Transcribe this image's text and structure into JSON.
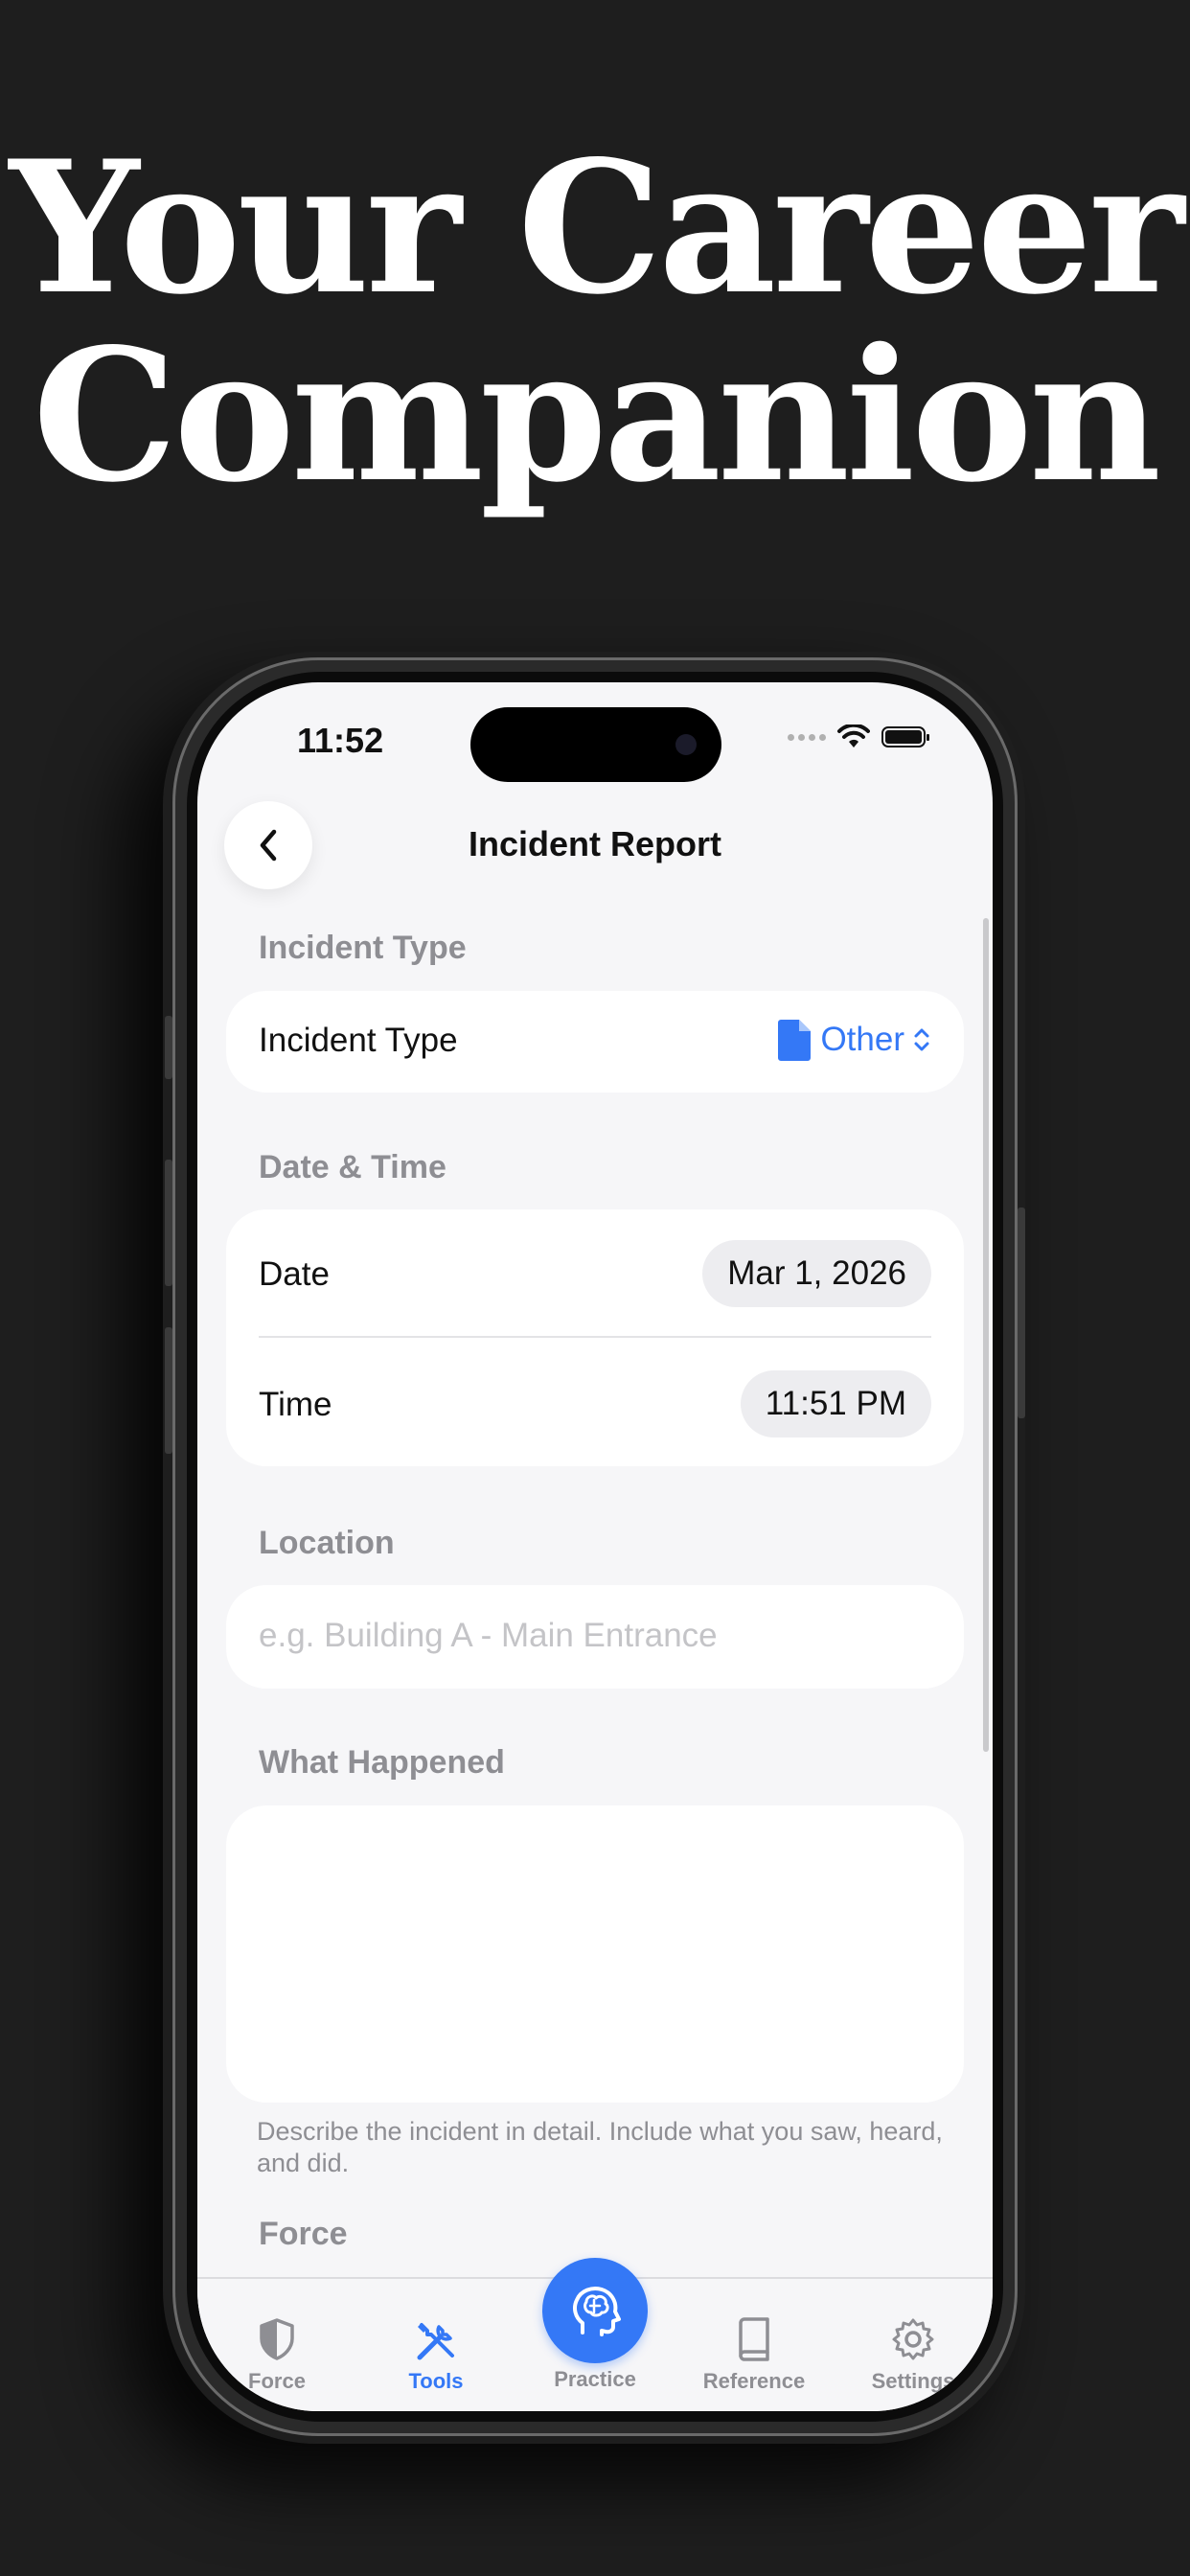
{
  "headline": {
    "line1": "Your Career",
    "line2": "Companion"
  },
  "status_bar": {
    "time": "11:52"
  },
  "nav": {
    "title": "Incident Report"
  },
  "incident_type": {
    "section_label": "Incident Type",
    "row_label": "Incident Type",
    "value": "Other"
  },
  "date_time": {
    "section_label": "Date & Time",
    "date_label": "Date",
    "date_value": "Mar 1, 2026",
    "time_label": "Time",
    "time_value": "11:51 PM"
  },
  "location": {
    "section_label": "Location",
    "placeholder": "e.g. Building A - Main Entrance",
    "value": ""
  },
  "what_happened": {
    "section_label": "What Happened",
    "value": "",
    "hint": "Describe the incident in detail. Include what you saw, heard, and did."
  },
  "force": {
    "section_label": "Force"
  },
  "tabbar": {
    "tabs": [
      {
        "label": "Force",
        "icon": "shield-icon"
      },
      {
        "label": "Tools",
        "icon": "tools-icon"
      },
      {
        "label": "Practice",
        "icon": "brain-head-icon"
      },
      {
        "label": "Reference",
        "icon": "book-icon"
      },
      {
        "label": "Settings",
        "icon": "gear-icon"
      }
    ],
    "active": "Tools"
  },
  "colors": {
    "accent": "#3478f6",
    "background": "#1e1e1e",
    "screen": "#f6f6f8"
  }
}
